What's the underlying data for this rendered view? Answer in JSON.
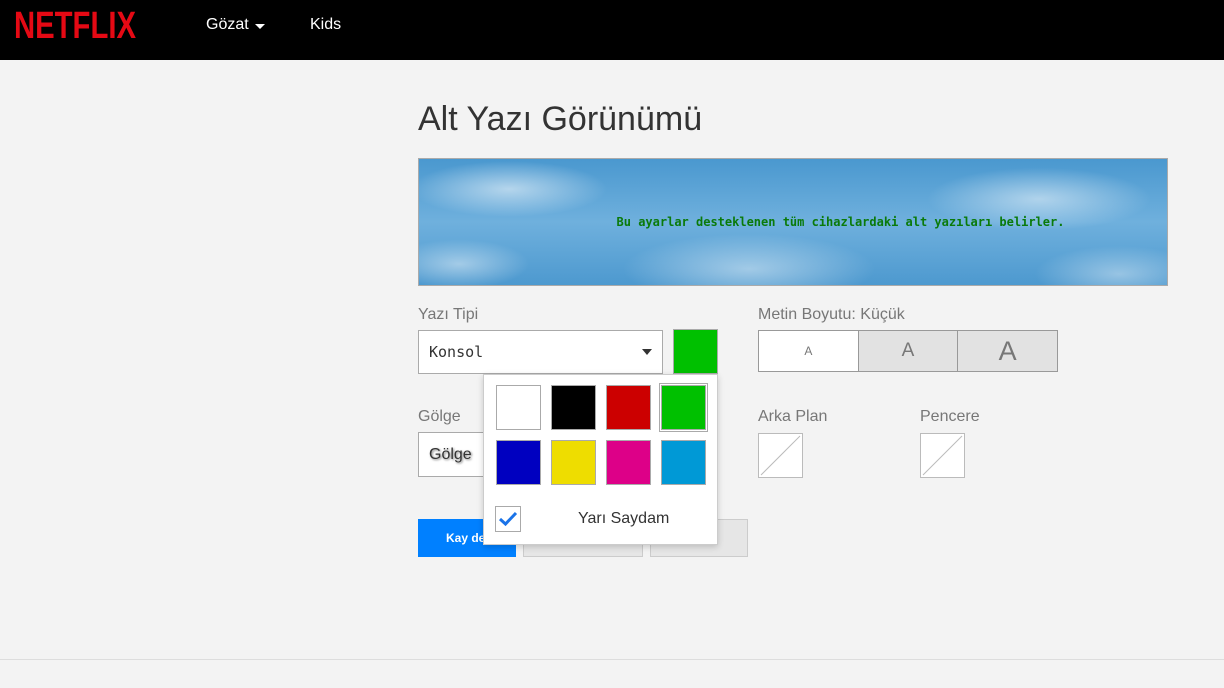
{
  "header": {
    "logo_text": "NETFLIX",
    "nav": {
      "browse": "Gözat",
      "kids": "Kids"
    },
    "brand_color": "#e50914"
  },
  "page": {
    "title": "Alt Yazı Görünümü",
    "preview_text": "Bu ayarlar desteklenen tüm cihazlardaki alt yazıları belirler."
  },
  "font": {
    "label": "Yazı Tipi",
    "value": "Konsol",
    "color": "#00c000"
  },
  "size": {
    "label": "Metin Boyutu: Küçük",
    "options": [
      "A",
      "A",
      "A"
    ],
    "selected": 0
  },
  "shadow": {
    "label": "Gölge",
    "value": "Gölge"
  },
  "background": {
    "label": "Arka Plan"
  },
  "window": {
    "label": "Pencere"
  },
  "actions": {
    "save": "Kay de"
  },
  "color_popup": {
    "colors": [
      "#ffffff",
      "#000000",
      "#cc0000",
      "#00c000",
      "#0000c0",
      "#eedd00",
      "#dd0088",
      "#0099d6"
    ],
    "selected_index": 3,
    "semi_transparent_label": "Yarı Saydam",
    "semi_transparent_checked": true,
    "check_color": "#1a73e8"
  }
}
